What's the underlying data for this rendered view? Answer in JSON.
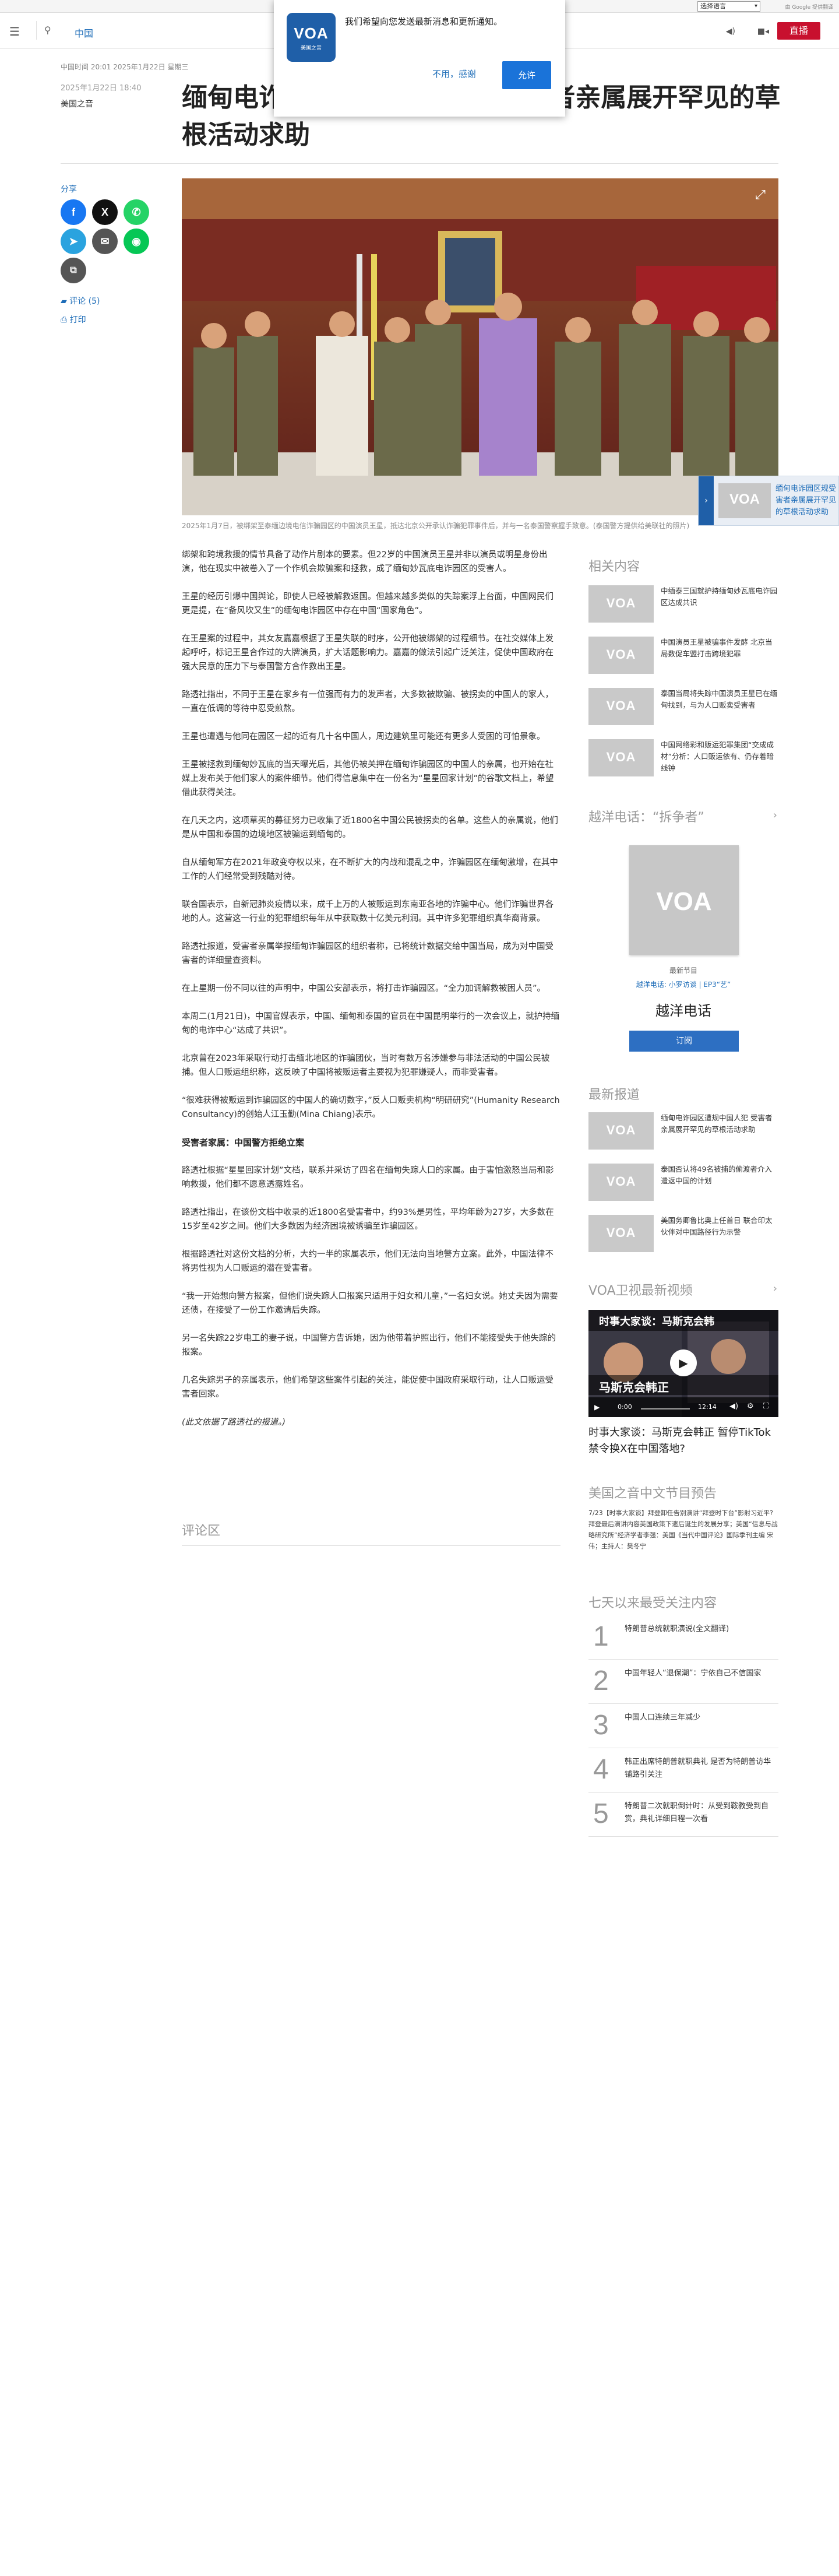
{
  "translate": {
    "select_label": "选择语言",
    "by": "由 Google 提供翻译"
  },
  "header": {
    "section": "中国",
    "live": "直播"
  },
  "popup": {
    "logo_text": "VOA",
    "logo_sub": "美国之音",
    "message": "我们希望向您发送最新消息和更新通知。",
    "decline": "不用，感谢",
    "accept": "允许"
  },
  "article": {
    "meta": "中国时间 20:01 2025年1月22日 星期三",
    "date": "2025年1月22日 18:40",
    "author": "美国之音",
    "title": "缅甸电诈园区遭规中国人犯 受害者亲属展开罕见的草根活动求助",
    "share_label": "分享",
    "comments_link": "评论 (5)",
    "print_link": "打印",
    "caption": "2025年1月7日，被绑架至泰缅边境电信诈骗园区的中国演员王星，抵达北京公开承认诈骗犯罪事件后，并与一名泰国警察握手致意。(泰国警方提供给美联社的照片)",
    "paragraphs": [
      "绑架和跨境救援的情节具备了动作片剧本的要素。但22岁的中国演员王星并非以演员或明星身份出演，他在现实中被卷入了一个作机会欺骗案和拯救，成了缅甸妙瓦底电诈园区的受害人。",
      "王星的经历引爆中国舆论，即使人已经被解救返国。但越来越多类似的失踪案浮上台面，中国网民们更是提，在“备风吹又生”的缅甸电诈园区中存在中国“国家角色”。",
      "在王星案的过程中，其女友嘉嘉根据了王星失联的时序，公开他被绑架的过程细节。在社交媒体上发起呼吁，标记王星合作过的大牌演员，扩大话题影响力。嘉嘉的做法引起广泛关注，促使中国政府在强大民意的压力下与泰国警方合作救出王星。",
      "路透社指出，不同于王星在家乡有一位强而有力的发声者，大多数被欺骗、被拐卖的中国人的家人，一直在低调的等待中忍受煎熬。",
      "王星也遭遇与他同在园区一起的近有几十名中国人，周边建筑里可能还有更多人受困的可怕景象。",
      "王星被拯救到缅甸妙瓦底的当天曝光后，其他仍被关押在缅甸诈骗园区的中国人的亲属，也开始在社媒上发布关于他们家人的案件细节。他们得信息集中在一份名为“星星回家计划”的谷歌文档上，希望借此获得关注。",
      "在几天之内，这项草买的募征努力已收集了近1800名中国公民被拐卖的名单。这些人的亲属说，他们是从中国和泰国的边境地区被骗运到缅甸的。",
      "自从缅甸军方在2021年政变夺权以来，在不断扩大的内战和混乱之中，诈骗园区在缅甸激增，在其中工作的人们经常受到残酷对待。",
      "联合国表示，自新冠肺炎疫情以来，成千上万的人被贩运到东南亚各地的诈骗中心。他们诈骗世界各地的人。这营这一行业的犯罪组织每年从中获取数十亿美元利润。其中许多犯罪组织真华裔背景。",
      "路透社报道，受害者亲属举报缅甸诈骗园区的组织者称，已将统计数据交给中国当局，成为对中国受害者的详细量查资料。",
      "在上星期一份不同以往的声明中，中国公安部表示，将打击诈骗园区。“全力加调解救被困人员”。",
      "本周二(1月21日)，中国官媒表示，中国、缅甸和泰国的官员在中国昆明举行的一次会议上，就护持缅甸的电诈中心“达成了共识”。",
      "北京曾在2023年采取行动打击缅北地区的诈骗团伙，当时有数万名涉嫌参与非法活动的中国公民被捕。但人口贩运组织称，这反映了中国将被贩运者主要视为犯罪嫌疑人，而非受害者。",
      "“很难获得被贩运到诈骗园区的中国人的确切数字，”反人口贩卖机构“明研研究”(Humanity Research Consultancy)的创始人江玉勤(Mina Chiang)表示。"
    ],
    "subheading": "受害者家属：中国警方拒绝立案",
    "paragraphs2": [
      "路透社根据“星星回家计划”文档，联系并采访了四名在缅甸失踪人口的家属。由于害怕激怒当局和影响救援，他们都不愿意透露姓名。",
      "路透社指出，在该份文档中收录的近1800名受害者中，约93%是男性，平均年龄为27岁，大多数在15岁至42岁之间。他们大多数因为经济困境被诱骗至诈骗园区。",
      "根据路透社对这份文档的分析，大约一半的家属表示，他们无法向当地警方立案。此外，中国法律不将男性视为人口贩运的潜在受害者。",
      "“我一开始想向警方报案，但他们说失踪人口报案只适用于妇女和儿童，”一名妇女说。她丈夫因为需要还债，在接受了一份工作邀请后失踪。",
      "另一名失踪22岁电工的妻子说，中国警方告诉她，因为他带着护照出行，他们不能接受失于他失踪的报案。",
      "几名失踪男子的亲属表示，他们希望这些案件引起的关注，能促使中国政府采取行动，让人口贩运受害者回家。"
    ],
    "note": "(此文依据了路透社的报道。)",
    "comments_area": "评论区"
  },
  "floating": {
    "text": "缅甸电诈园区规受害者亲属展开罕见的草根活动求助"
  },
  "related": {
    "title": "相关内容",
    "items": [
      {
        "text": "中缅泰三国就护持缅甸妙瓦底电诈园区达成共识"
      },
      {
        "text": "中国演员王星被骗事件发酵 北京当局数促车盟打击跨境犯罪"
      },
      {
        "text": "泰国当局将失踪中国演员王星已在缅甸找到，与为人口贩卖受害者"
      },
      {
        "text": "中国网络彩和贩运犯罪集团“交成成材”分析：人口贩运依有、仍存着暗线钟"
      }
    ]
  },
  "podcast": {
    "title": "越洋电话：“拆争者”",
    "cover_text": "VOA",
    "category": "最新节目",
    "program": "越洋电话: 小罗访谈 | EP3“艺”",
    "name": "越洋电话",
    "subscribe": "订阅"
  },
  "latest": {
    "title": "最新报道",
    "items": [
      {
        "text": "缅甸电诈园区遭规中国人犯 受害者亲属展开罕见的草根活动求助"
      },
      {
        "text": "泰国否认将49名被捕的偷渡者介入遣返中国的计划"
      },
      {
        "text": "美国务卿鲁比奥上任首日 联合印太伙伴对中国路径行为示警"
      }
    ]
  },
  "video": {
    "title": "VOA卫视最新视频",
    "overlay_top": "时事大家谈：马斯克会韩",
    "overlay_bottom": "马斯克会韩正",
    "time_now": "0:00",
    "time_total": "12:14",
    "headline": "时事大家谈：马斯克会韩正 暂停TikTok禁令换X在中国落地?"
  },
  "preview": {
    "title": "美国之音中文节目预告",
    "text": "7/23【时事大家谈】拜登卸任告别演讲“拜登时下台”影射习近平? 拜登最后演讲内容美国政策下遗后诞生的发展分享；美国“信息与战略研究所”经济学者李强：美国《当代中国评论》国际季刊主编 宋伟；主持人：樊冬宁"
  },
  "most_read": {
    "title": "七天以来最受关注内容",
    "items": [
      {
        "num": "1",
        "text": "特朗普总统就职演说(全文翻译)"
      },
      {
        "num": "2",
        "text": "中国年轻人“退保潮”：宁依自己不信国家"
      },
      {
        "num": "3",
        "text": "中国人口连续三年减少"
      },
      {
        "num": "4",
        "text": "韩正出席特朗普就职典礼 是否为特朗普访华铺路引关注"
      },
      {
        "num": "5",
        "text": "特朗普二次就职倒计时：从受到鞍教受到自赏，典礼详细日程一次看"
      }
    ]
  }
}
